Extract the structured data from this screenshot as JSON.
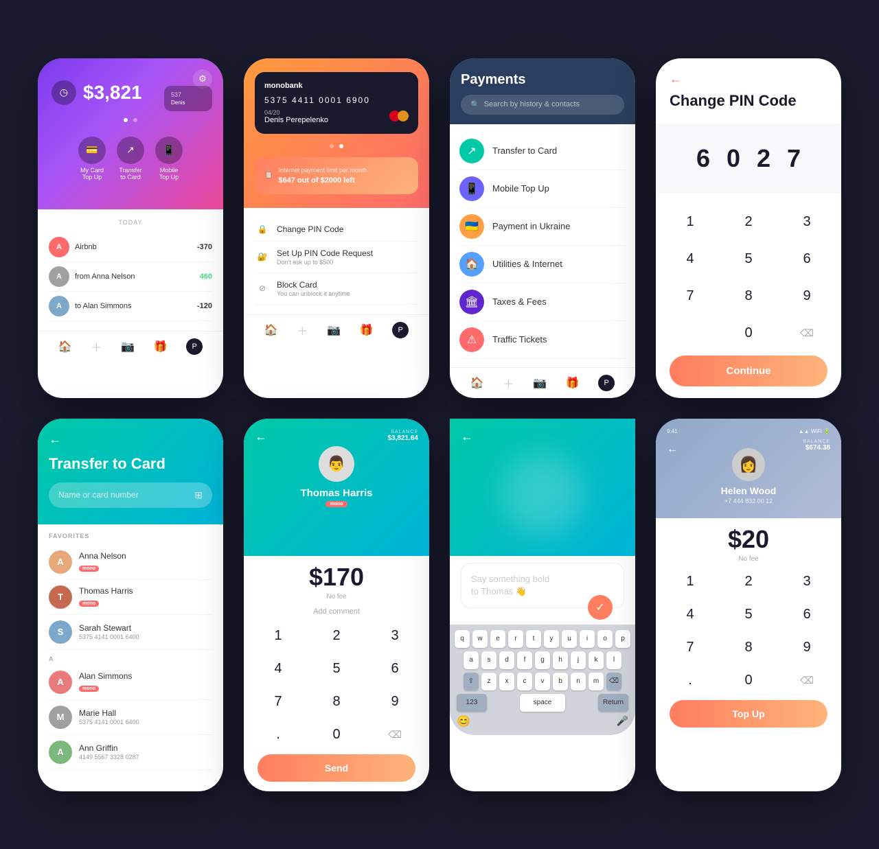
{
  "phones": {
    "p1": {
      "balance": "$3,821",
      "card_last": "537",
      "card_holder": "Denis",
      "today_label": "TODAY",
      "transactions": [
        {
          "name": "Airbnb",
          "amount": "-370",
          "type": "neg",
          "color": "#ff6b6b"
        },
        {
          "name": "from Anna Nelson",
          "amount": "460",
          "type": "pos"
        },
        {
          "name": "to Alan Simmons",
          "amount": "-120",
          "type": "neg"
        }
      ],
      "actions": [
        {
          "label": "My Card\nTop Up",
          "icon": "💳"
        },
        {
          "label": "Transfer\nto Card",
          "icon": "↗"
        },
        {
          "label": "Mobile\nTop Up",
          "icon": "📱"
        }
      ]
    },
    "p2": {
      "bank": "monobank",
      "card_number": "5375  4411  0001  6900",
      "card_date": "04/20",
      "card_holder": "Denis Perepelenko",
      "limit_title": "Internet payment limit per month",
      "limit_text": "$647 out of $2000 left",
      "menu": [
        {
          "title": "Change PIN Code",
          "icon": "🔒",
          "sub": ""
        },
        {
          "title": "Set Up PIN Code Request",
          "icon": "🔐",
          "sub": "Don't ask up to $500"
        },
        {
          "title": "Block Card",
          "icon": "⊘",
          "sub": "You can unblock it anytime"
        }
      ]
    },
    "p3": {
      "title": "Payments",
      "search_placeholder": "Search by history & contacts",
      "items": [
        {
          "label": "Transfer to Card",
          "icon": "↗",
          "color": "#00c9a7"
        },
        {
          "label": "Mobile Top Up",
          "icon": "📱",
          "color": "#6c63ff"
        },
        {
          "label": "Payment in Ukraine",
          "icon": "🇺🇦",
          "color": "#ff9f43"
        },
        {
          "label": "Utilities & Internet",
          "icon": "🏠",
          "color": "#54a0ff"
        },
        {
          "label": "Taxes & Fees",
          "icon": "🏛",
          "color": "#5f27cd"
        },
        {
          "label": "Traffic Tickets",
          "icon": "⚠",
          "color": "#ff6b6b"
        }
      ]
    },
    "p4": {
      "title": "Change PIN Code",
      "pin": [
        "6",
        "0",
        "2",
        "7"
      ],
      "keys": [
        [
          "1",
          "2",
          "3"
        ],
        [
          "4",
          "5",
          "6"
        ],
        [
          "7",
          "8",
          "9"
        ],
        [
          "",
          "0",
          "⌫"
        ]
      ],
      "continue_label": "Continue"
    },
    "p5": {
      "title": "Transfer to Card",
      "input_placeholder": "Name or card number",
      "fav_label": "FAVORITES",
      "contacts": [
        {
          "name": "Anna Nelson",
          "badge": "mono",
          "num": "",
          "color": "#e8a87c"
        },
        {
          "name": "Thomas Harris",
          "badge": "mono",
          "num": "",
          "color": "#c56a50"
        },
        {
          "name": "Sarah Stewart",
          "badge": "",
          "num": "5375 4141 0001 6400",
          "color": "#7ea8c9"
        },
        {
          "name": "Alan Simmons",
          "badge": "mono",
          "num": "",
          "color": "#e87c7c"
        },
        {
          "name": "Marie Hall",
          "badge": "",
          "num": "5375 4141 0001 6400",
          "color": "#a0a0a0"
        },
        {
          "name": "Ann Griffin",
          "badge": "",
          "num": "4149 5567 3328 0287",
          "color": "#7cb87c"
        }
      ],
      "section_label": "A"
    },
    "p6": {
      "balance_label": "BALANCE",
      "balance": "$3,821.64",
      "name": "Thomas Harris",
      "badge": "mono",
      "amount": "$170",
      "fee": "No fee",
      "comment": "Add comment",
      "keys": [
        [
          "1",
          "2",
          "3"
        ],
        [
          "4",
          "5",
          "6"
        ],
        [
          "7",
          "8",
          "9"
        ],
        [
          ".",
          "0",
          "⌫"
        ]
      ],
      "send_label": "Send"
    },
    "p7": {
      "message_placeholder": "Say something bold\nto Thomas 👋",
      "keyboard": {
        "row1": [
          "q",
          "w",
          "e",
          "r",
          "t",
          "y",
          "u",
          "i",
          "o",
          "p"
        ],
        "row2": [
          "a",
          "s",
          "d",
          "f",
          "g",
          "h",
          "j",
          "k",
          "l"
        ],
        "row3": [
          "z",
          "x",
          "c",
          "v",
          "b",
          "n",
          "m"
        ],
        "row4_left": "123",
        "row4_mid": "space",
        "row4_right": "Return"
      }
    },
    "p8": {
      "time": "9:41",
      "balance_label": "BALANCE",
      "balance": "$674.38",
      "name": "Helen Wood",
      "phone": "+7 444 832 00 12",
      "amount": "$20",
      "fee": "No fee",
      "keys": [
        [
          "1",
          "2",
          "3"
        ],
        [
          "4",
          "5",
          "6"
        ],
        [
          "7",
          "8",
          "9"
        ],
        [
          ".",
          "0",
          "⌫"
        ]
      ],
      "topup_label": "Top Up"
    }
  }
}
